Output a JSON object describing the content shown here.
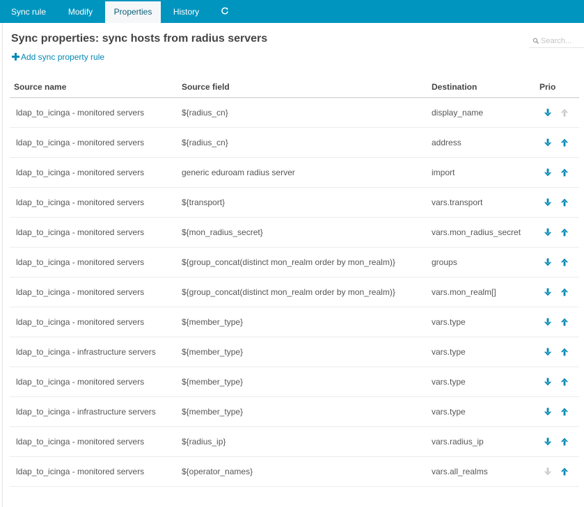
{
  "tabs": [
    {
      "label": "Sync rule",
      "active": false
    },
    {
      "label": "Modify",
      "active": false
    },
    {
      "label": "Properties",
      "active": true
    },
    {
      "label": "History",
      "active": false
    },
    {
      "label": "",
      "icon": "refresh-icon",
      "active": false
    }
  ],
  "page": {
    "title": "Sync properties: sync hosts from radius servers",
    "add_rule_label": "Add sync property rule"
  },
  "search": {
    "placeholder": "Search...",
    "value": ""
  },
  "colors": {
    "tab_bar": "#0095bf",
    "link": "#0088b3",
    "arrow_enabled": "#0088b3",
    "arrow_disabled": "#c9c9c9"
  },
  "table": {
    "headers": [
      "Source name",
      "Source field",
      "Destination",
      "Prio"
    ],
    "rows": [
      {
        "source": "ldap_to_icinga - monitored servers",
        "field": "${radius_cn}",
        "destination": "display_name",
        "down": true,
        "up": false
      },
      {
        "source": "ldap_to_icinga - monitored servers",
        "field": "${radius_cn}",
        "destination": "address",
        "down": true,
        "up": true
      },
      {
        "source": "ldap_to_icinga - monitored servers",
        "field": "generic eduroam radius server",
        "destination": "import",
        "down": true,
        "up": true
      },
      {
        "source": "ldap_to_icinga - monitored servers",
        "field": "${transport}",
        "destination": "vars.transport",
        "down": true,
        "up": true
      },
      {
        "source": "ldap_to_icinga - monitored servers",
        "field": "${mon_radius_secret}",
        "destination": "vars.mon_radius_secret",
        "down": true,
        "up": true
      },
      {
        "source": "ldap_to_icinga - monitored servers",
        "field": "${group_concat(distinct mon_realm order by mon_realm)}",
        "destination": "groups",
        "down": true,
        "up": true
      },
      {
        "source": "ldap_to_icinga - monitored servers",
        "field": "${group_concat(distinct mon_realm order by mon_realm)}",
        "destination": "vars.mon_realm[]",
        "down": true,
        "up": true
      },
      {
        "source": "ldap_to_icinga - monitored servers",
        "field": "${member_type}",
        "destination": "vars.type",
        "down": true,
        "up": true
      },
      {
        "source": "ldap_to_icinga - infrastructure servers",
        "field": "${member_type}",
        "destination": "vars.type",
        "down": true,
        "up": true
      },
      {
        "source": "ldap_to_icinga - monitored servers",
        "field": "${member_type}",
        "destination": "vars.type",
        "down": true,
        "up": true
      },
      {
        "source": "ldap_to_icinga - infrastructure servers",
        "field": "${member_type}",
        "destination": "vars.type",
        "down": true,
        "up": true
      },
      {
        "source": "ldap_to_icinga - monitored servers",
        "field": "${radius_ip}",
        "destination": "vars.radius_ip",
        "down": true,
        "up": true
      },
      {
        "source": "ldap_to_icinga - monitored servers",
        "field": "${operator_names}",
        "destination": "vars.all_realms",
        "down": false,
        "up": true
      }
    ]
  }
}
